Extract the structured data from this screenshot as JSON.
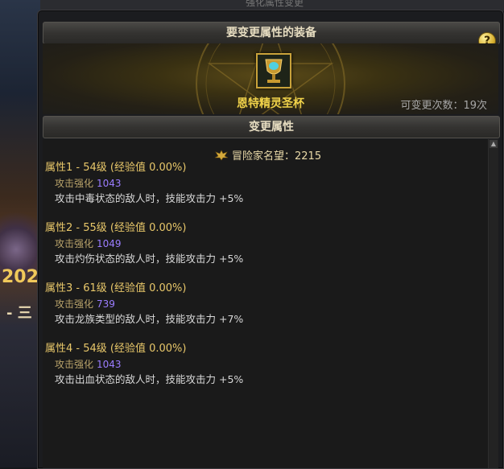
{
  "top_title": "强化属性变更",
  "background": {
    "banner_text": "202",
    "banner_sub": "- 三"
  },
  "panel": {
    "header_equipment": "要变更属性的装备",
    "help_label": "?",
    "item_name": "恩特精灵圣杯",
    "change_count_label": "可变更次数：19次",
    "header_change": "变更属性",
    "fame_label": "冒险家名望：2215",
    "scroll_up": "▲"
  },
  "attributes": [
    {
      "title": "属性1 - 54级 (经验值 0.00%)",
      "stat_label": "攻击强化",
      "stat_value": "1043",
      "effect": "攻击中毒状态的敌人时，技能攻击力 +5%"
    },
    {
      "title": "属性2 - 55级 (经验值 0.00%)",
      "stat_label": "攻击强化",
      "stat_value": "1049",
      "effect": "攻击灼伤状态的敌人时，技能攻击力 +5%"
    },
    {
      "title": "属性3 - 61级 (经验值 0.00%)",
      "stat_label": "攻击强化",
      "stat_value": "739",
      "effect": "攻击龙族类型的敌人时，技能攻击力 +7%"
    },
    {
      "title": "属性4 - 54级 (经验值 0.00%)",
      "stat_label": "攻击强化",
      "stat_value": "1043",
      "effect": "攻击出血状态的敌人时，技能攻击力 +5%"
    }
  ],
  "colors": {
    "title_gold": "#e9c86a",
    "stat_value_purple": "#9b7dff",
    "item_name_yellow": "#f0d24a"
  },
  "icons": {
    "item": "grail-icon",
    "fame": "fame-emblem-icon",
    "help": "help-icon"
  }
}
